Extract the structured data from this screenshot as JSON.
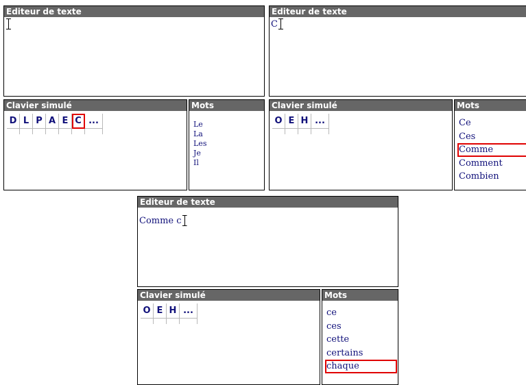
{
  "stages": [
    {
      "editor": {
        "title": "Editeur de texte",
        "text": ""
      },
      "keyboard": {
        "title": "Clavier simulé",
        "keys": [
          "D",
          "L",
          "P",
          "A",
          "E",
          "C",
          "..."
        ],
        "highlighted": "C"
      },
      "words": {
        "title": "Mots",
        "items": [
          "Le",
          "La",
          "Les",
          "Je",
          "Il"
        ],
        "highlighted": null
      }
    },
    {
      "editor": {
        "title": "Editeur de texte",
        "text": "C"
      },
      "keyboard": {
        "title": "Clavier simulé",
        "keys": [
          "O",
          "E",
          "H",
          "..."
        ],
        "highlighted": null
      },
      "words": {
        "title": "Mots",
        "items": [
          "Ce",
          "Ces",
          "Comme",
          "Comment",
          "Combien"
        ],
        "highlighted": "Comme"
      }
    },
    {
      "editor": {
        "title": "Editeur de texte",
        "text": "Comme c"
      },
      "keyboard": {
        "title": "Clavier simulé",
        "keys": [
          "O",
          "E",
          "H",
          "..."
        ],
        "highlighted": null
      },
      "words": {
        "title": "Mots",
        "items": [
          "ce",
          "ces",
          "cette",
          "certains",
          "chaque"
        ],
        "highlighted": "chaque"
      }
    }
  ],
  "colors": {
    "title_bar": "#666666",
    "text": "#10107a",
    "highlight": "#e00000"
  }
}
